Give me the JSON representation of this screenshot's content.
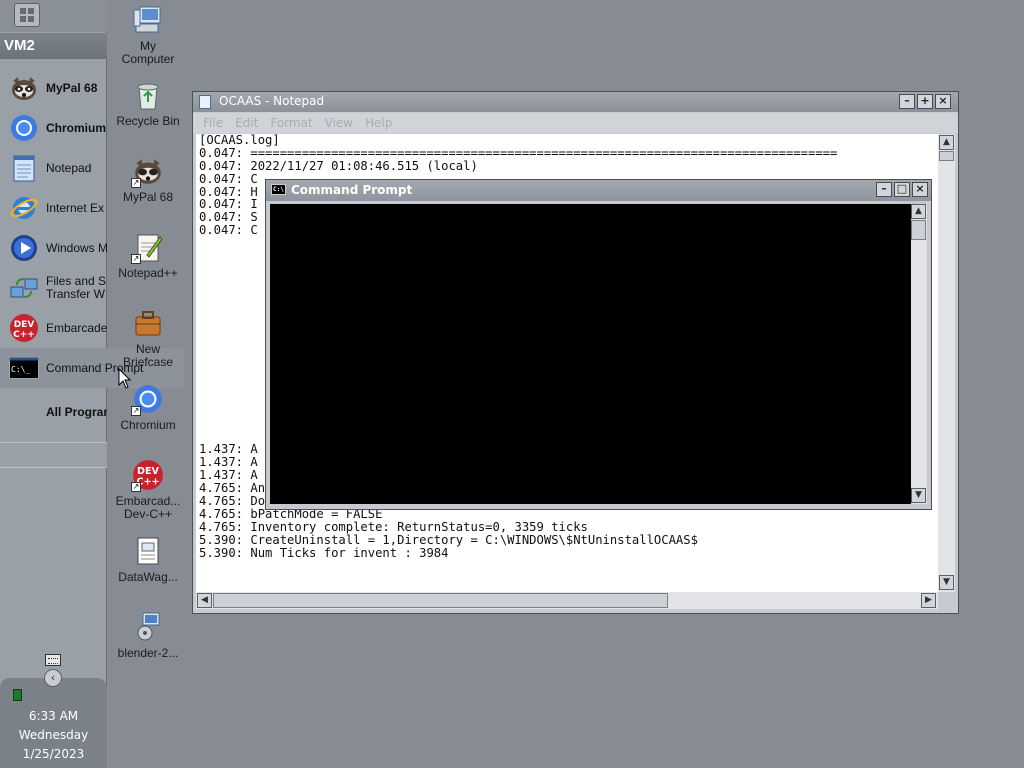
{
  "panel": {
    "title": "VM2",
    "programs": [
      {
        "label": "MyPal 68",
        "icon": "mypal-icon",
        "bold": true
      },
      {
        "label": "Chromium",
        "icon": "chromium-icon",
        "bold": true
      },
      {
        "label": "Notepad",
        "icon": "notepad-icon",
        "bold": false
      },
      {
        "label": "Internet Ex",
        "icon": "internet-explorer-icon",
        "bold": false
      },
      {
        "label": "Windows M",
        "icon": "windows-media-player-icon",
        "bold": false
      },
      {
        "label": "Files and S\nTransfer W",
        "icon": "files-settings-transfer-icon",
        "bold": false
      },
      {
        "label": "Embarcade",
        "icon": "devcpp-icon",
        "bold": false
      },
      {
        "label": "Command Prompt",
        "icon": "command-prompt-icon",
        "bold": false
      }
    ],
    "all_programs": "All Programs",
    "clock": {
      "time": "6:33 AM",
      "day": "Wednesday",
      "date": "1/25/2023"
    }
  },
  "desktop": {
    "icons": [
      {
        "label": "My\nComputer",
        "icon": "my-computer-icon"
      },
      {
        "label": "Recycle Bin",
        "icon": "recycle-bin-icon"
      },
      {
        "label": "MyPal 68",
        "icon": "mypal-icon"
      },
      {
        "label": "Notepad++",
        "icon": "notepad-plus-plus-icon"
      },
      {
        "label": "New\nBriefcase",
        "icon": "briefcase-icon"
      },
      {
        "label": "Chromium",
        "icon": "chromium-icon"
      },
      {
        "label": "Embarcad...\nDev-C++",
        "icon": "devcpp-icon"
      },
      {
        "label": "DataWag...",
        "icon": "datawag-icon"
      },
      {
        "label": "blender-2...",
        "icon": "blender-installer-icon"
      }
    ]
  },
  "notepad": {
    "title": "OCAAS - Notepad",
    "menu": [
      "File",
      "Edit",
      "Format",
      "View",
      "Help"
    ],
    "lines": [
      "[OCAAS.log]",
      "0.047: ================================================================================",
      "0.047: 2022/11/27 01:08:46.515 (local)",
      "0.047: C",
      "0.047: H",
      "0.047: I",
      "0.047: S",
      "0.047: C",
      "",
      "",
      "",
      "",
      "",
      "",
      "",
      "",
      "",
      "",
      "",
      "",
      "",
      "",
      "",
      "",
      "1.437: A",
      "1.437: A",
      "1.437: A",
      "4.765: AnalyzeComponents used 3359 ticks",
      "4.765: Downloading 0 files",
      "4.765: bPatchMode = FALSE",
      "4.765: Inventory complete: ReturnStatus=0, 3359 ticks",
      "5.390: CreateUninstall = 1,Directory = C:\\WINDOWS\\$NtUninstallOCAAS$",
      "5.390: Num Ticks for invent : 3984"
    ]
  },
  "cmd": {
    "title": "Command Prompt",
    "icon_text": "C:\\"
  },
  "colors": {
    "desktop_bg": "#868b94",
    "panel_bg": "#9aa0a8"
  }
}
